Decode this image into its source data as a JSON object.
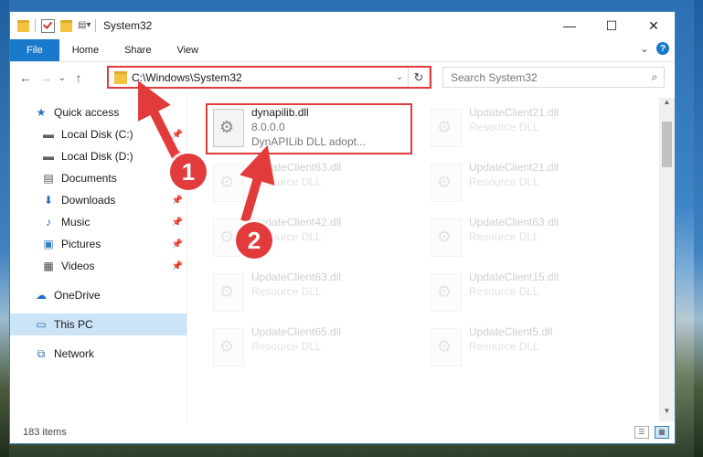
{
  "window": {
    "title": "System32",
    "controls": {
      "minimize": "—",
      "maximize": "☐",
      "close": "✕"
    }
  },
  "ribbon": {
    "tabs": [
      "File",
      "Home",
      "Share",
      "View"
    ],
    "expand_label": "⌄",
    "help_label": "?"
  },
  "address_bar": {
    "path": "C:\\Windows\\System32",
    "dropdown": "⌄",
    "refresh": "↻"
  },
  "search": {
    "placeholder": "Search System32",
    "icon": "⌕"
  },
  "nav": {
    "back": "←",
    "forward": "→",
    "recent": "⌄",
    "up": "↑"
  },
  "sidebar": {
    "items": [
      {
        "label": "Quick access",
        "icon": "star-icon",
        "glyph": "★",
        "color": "#2f6fba",
        "pinned": false
      },
      {
        "label": "Local Disk (C:)",
        "icon": "drive-icon",
        "glyph": "▬",
        "color": "#606060",
        "pinned": true
      },
      {
        "label": "Local Disk (D:)",
        "icon": "drive-icon",
        "glyph": "▬",
        "color": "#606060",
        "pinned": true
      },
      {
        "label": "Documents",
        "icon": "documents-icon",
        "glyph": "▤",
        "color": "#555",
        "pinned": true
      },
      {
        "label": "Downloads",
        "icon": "download-icon",
        "glyph": "⬇",
        "color": "#1e6fc6",
        "pinned": true
      },
      {
        "label": "Music",
        "icon": "music-icon",
        "glyph": "♪",
        "color": "#1e6fc6",
        "pinned": true
      },
      {
        "label": "Pictures",
        "icon": "pictures-icon",
        "glyph": "▣",
        "color": "#3a7cc0",
        "pinned": true
      },
      {
        "label": "Videos",
        "icon": "videos-icon",
        "glyph": "▦",
        "color": "#444",
        "pinned": true
      },
      {
        "label": "OneDrive",
        "icon": "cloud-icon",
        "glyph": "☁",
        "color": "#1e6fc6",
        "pinned": false
      },
      {
        "label": "This PC",
        "icon": "computer-icon",
        "glyph": "▭",
        "color": "#2f6fba",
        "pinned": false,
        "selected": true
      },
      {
        "label": "Network",
        "icon": "network-icon",
        "glyph": "⧉",
        "color": "#2f6fba",
        "pinned": false
      }
    ],
    "pin_glyph": "📌"
  },
  "files": [
    {
      "name": "dynapilib.dll",
      "line2": "8.0.0.0",
      "line3": "DynAPILib DLL adopt...",
      "focus": true
    },
    {
      "name": "UpdateClient21.dll",
      "line2": "Resource DLL"
    },
    {
      "name": "UpdateClient63.dll",
      "line2": "Resource DLL"
    },
    {
      "name": "UpdateClient21.dll",
      "line2": "Resource DLL"
    },
    {
      "name": "UpdateClient42.dll",
      "line2": "Resource DLL"
    },
    {
      "name": "UpdateClient63.dll",
      "line2": "Resource DLL"
    },
    {
      "name": "UpdateClient63.dll",
      "line2": "Resource DLL"
    },
    {
      "name": "UpdateClient15.dll",
      "line2": "Resource DLL"
    },
    {
      "name": "UpdateClient65.dll",
      "line2": "Resource DLL"
    },
    {
      "name": "UpdateClient5.dll",
      "line2": "Resource DLL"
    }
  ],
  "status": {
    "count_text": "183 items"
  },
  "annotations": {
    "marker1": "1",
    "marker2": "2",
    "accent": "#e23b3b"
  }
}
